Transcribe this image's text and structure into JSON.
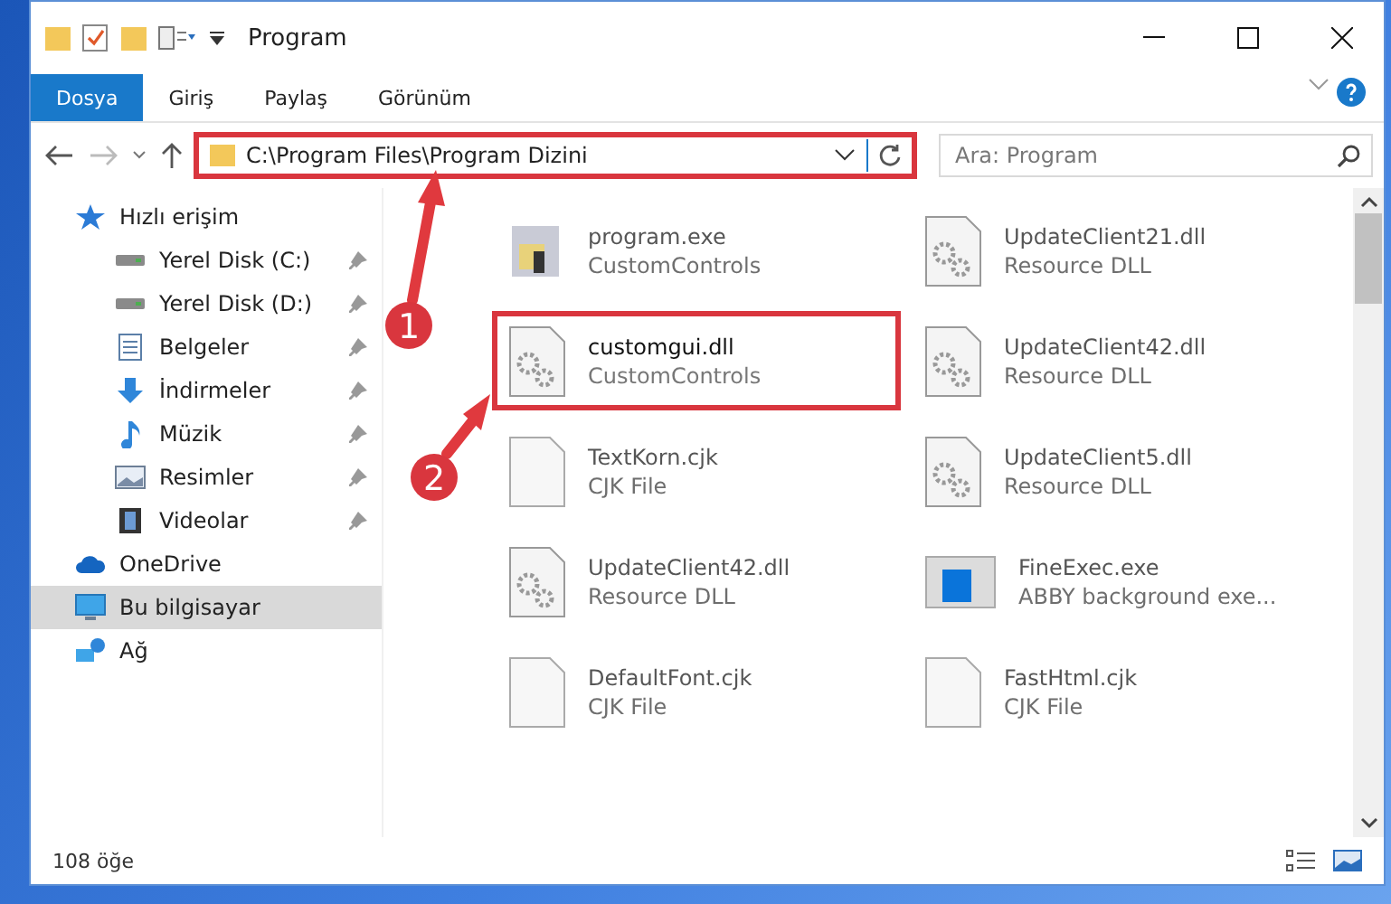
{
  "window": {
    "title": "Program"
  },
  "ribbon_tabs": [
    {
      "label": "Dosya",
      "selected": true
    },
    {
      "label": "Giriş",
      "selected": false
    },
    {
      "label": "Paylaş",
      "selected": false
    },
    {
      "label": "Görünüm",
      "selected": false
    }
  ],
  "address_bar": {
    "path": "C:\\Program Files\\Program Dizini",
    "highlighted": true
  },
  "search": {
    "placeholder": "Ara: Program"
  },
  "sidebar": {
    "items": [
      {
        "label": "Hızlı erişim",
        "kind": "quick",
        "selected": false,
        "children": [
          {
            "label": "Yerel Disk (C:)",
            "kind": "drive",
            "selected": false,
            "pinned": true
          },
          {
            "label": "Yerel Disk (D:)",
            "kind": "drive",
            "selected": false,
            "pinned": true
          },
          {
            "label": "Belgeler",
            "kind": "documents",
            "selected": false,
            "pinned": true
          },
          {
            "label": "İndirmeler",
            "kind": "downloads",
            "selected": false,
            "pinned": true
          },
          {
            "label": "Müzik",
            "kind": "music",
            "selected": false,
            "pinned": true
          },
          {
            "label": "Resimler",
            "kind": "pictures",
            "selected": false,
            "pinned": true
          },
          {
            "label": "Videolar",
            "kind": "videos",
            "selected": false,
            "pinned": true
          }
        ]
      },
      {
        "label": "OneDrive",
        "kind": "cloud",
        "selected": false
      },
      {
        "label": "Bu bilgisayar",
        "kind": "computer",
        "selected": true
      },
      {
        "label": "Ağ",
        "kind": "network",
        "selected": false
      }
    ]
  },
  "files": [
    {
      "name": "program.exe",
      "type": "CustomControls",
      "kind": "exe",
      "blurred": true,
      "highlighted": false
    },
    {
      "name": "UpdateClient21.dll",
      "type": "Resource DLL",
      "kind": "dll",
      "blurred": true,
      "highlighted": false
    },
    {
      "name": "customgui.dll",
      "type": "CustomControls",
      "kind": "dll",
      "blurred": false,
      "highlighted": true
    },
    {
      "name": "UpdateClient42.dll",
      "type": "Resource DLL",
      "kind": "dll",
      "blurred": true,
      "highlighted": false
    },
    {
      "name": "TextKorn.cjk",
      "type": "CJK File",
      "kind": "file",
      "blurred": true,
      "highlighted": false
    },
    {
      "name": "UpdateClient5.dll",
      "type": "Resource DLL",
      "kind": "dll",
      "blurred": true,
      "highlighted": false
    },
    {
      "name": "UpdateClient42.dll",
      "type": "Resource DLL",
      "kind": "dll",
      "blurred": true,
      "highlighted": false
    },
    {
      "name": "FineExec.exe",
      "type": "ABBY background exe...",
      "kind": "app",
      "blurred": true,
      "highlighted": false
    },
    {
      "name": "DefaultFont.cjk",
      "type": "CJK File",
      "kind": "file",
      "blurred": true,
      "highlighted": false
    },
    {
      "name": "FastHtml.cjk",
      "type": "CJK File",
      "kind": "file",
      "blurred": true,
      "highlighted": false
    }
  ],
  "status_bar": {
    "count": "108 öğe"
  },
  "annotations": [
    {
      "number": "1"
    },
    {
      "number": "2"
    }
  ]
}
